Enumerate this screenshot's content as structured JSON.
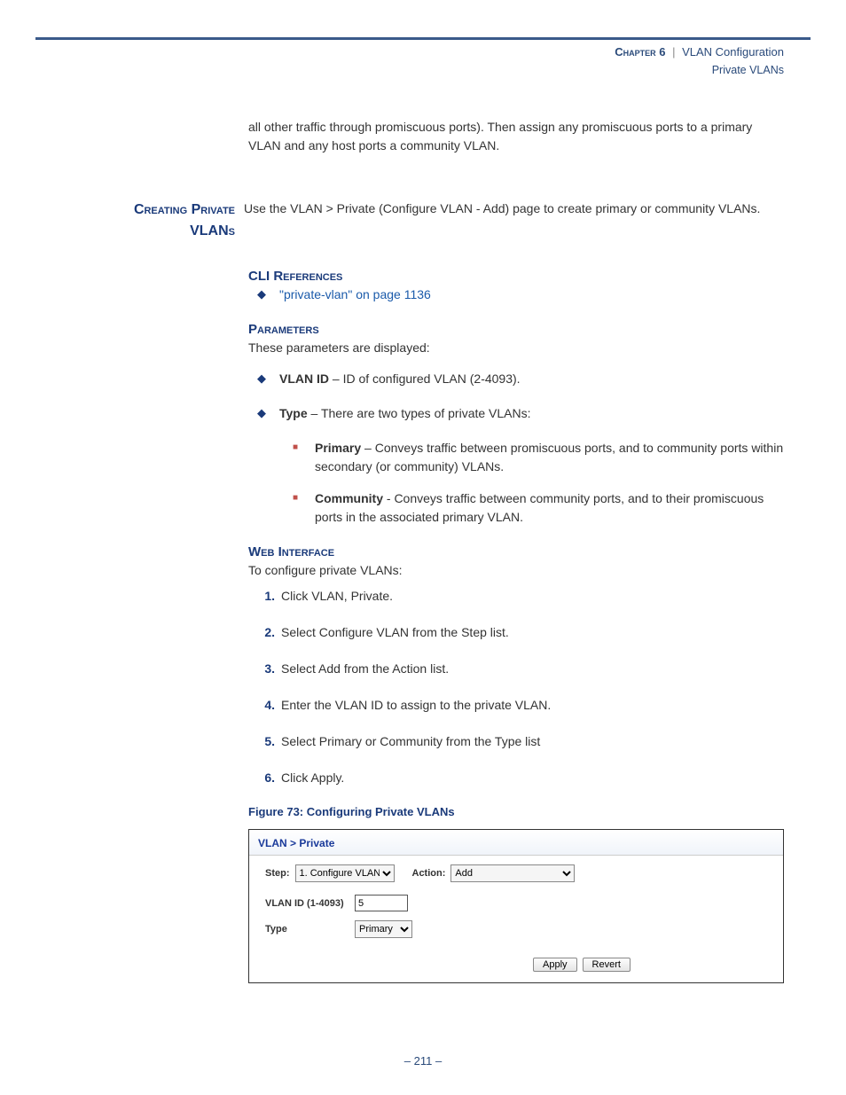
{
  "header": {
    "chapter_word": "Chapter",
    "chapter_num": "6",
    "divider": "|",
    "title": "VLAN Configuration",
    "subtitle": "Private VLANs"
  },
  "intro_paragraph": "all other traffic through promiscuous ports). Then assign any promiscuous ports to a primary VLAN and any host ports a community VLAN.",
  "section": {
    "side_heading_line1": "Creating Private",
    "side_heading_line2": "VLANs",
    "intro": "Use the VLAN > Private (Configure VLAN - Add) page to create primary or community VLANs."
  },
  "cli_refs": {
    "heading": "CLI References",
    "link": "\"private-vlan\" on page 1136"
  },
  "parameters": {
    "heading": "Parameters",
    "intro": "These parameters are displayed:",
    "items": [
      {
        "term": "VLAN ID",
        "desc": " – ID of configured VLAN (2-4093)."
      },
      {
        "term": "Type",
        "desc": " – There are two types of private VLANs:"
      }
    ],
    "subitems": [
      {
        "term": "Primary",
        "desc": " – Conveys traffic between promiscuous ports, and to community ports within secondary (or community) VLANs."
      },
      {
        "term": "Community",
        "desc": " - Conveys traffic between community ports, and to their promiscuous ports in the associated primary VLAN."
      }
    ]
  },
  "web_interface": {
    "heading": "Web Interface",
    "intro": "To configure private VLANs:",
    "steps": [
      "Click VLAN, Private.",
      "Select Configure VLAN from the Step list.",
      "Select Add from the Action list.",
      "Enter the VLAN ID to assign to the private VLAN.",
      "Select Primary or Community from the Type list",
      "Click Apply."
    ]
  },
  "figure": {
    "caption": "Figure 73:  Configuring Private VLANs",
    "breadcrumb": "VLAN > Private",
    "step_label": "Step:",
    "step_value": "1. Configure VLAN",
    "action_label": "Action:",
    "action_value": "Add",
    "vlan_id_label": "VLAN ID (1-4093)",
    "vlan_id_value": "5",
    "type_label": "Type",
    "type_value": "Primary",
    "apply_label": "Apply",
    "revert_label": "Revert"
  },
  "page_number": "–  211  –"
}
